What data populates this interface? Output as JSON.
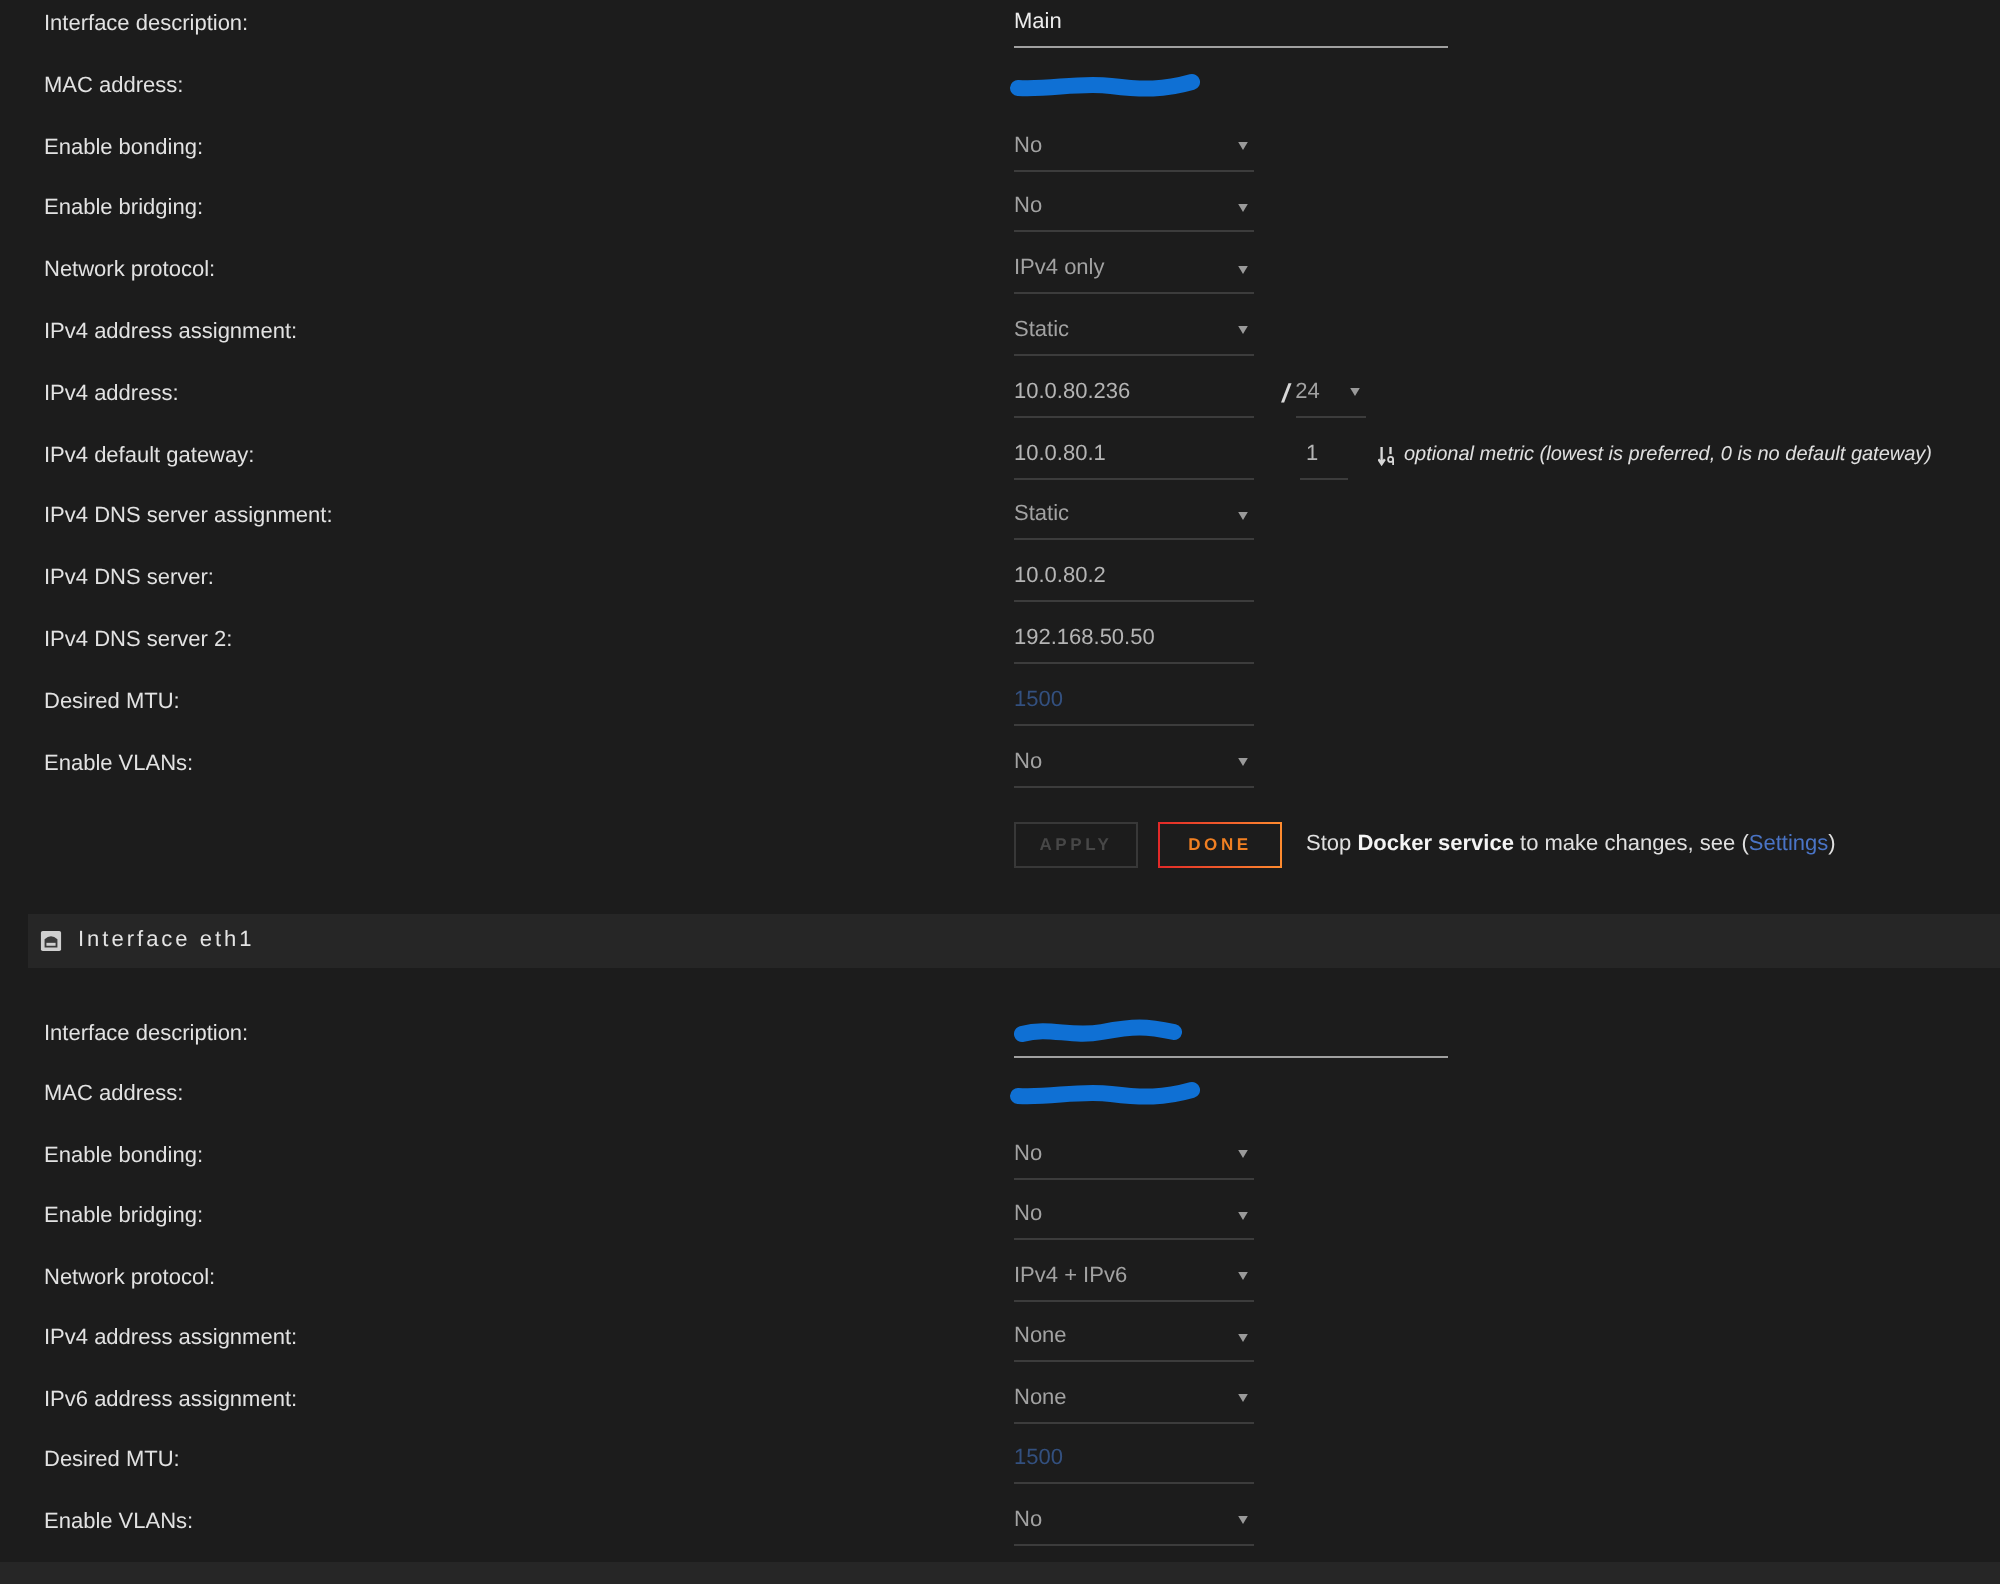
{
  "sections": [
    {
      "rows": [
        {
          "label": "Interface description:",
          "kind": "wide_input",
          "value": "Main",
          "redacted": false
        },
        {
          "label": "MAC address:",
          "kind": "text",
          "redacted": true
        },
        {
          "label": "Enable bonding:",
          "kind": "select",
          "value": "No"
        },
        {
          "label": "Enable bridging:",
          "kind": "select",
          "value": "No"
        },
        {
          "label": "Network protocol:",
          "kind": "select",
          "value": "IPv4 only"
        },
        {
          "label": "IPv4 address assignment:",
          "kind": "select",
          "value": "Static"
        },
        {
          "label": "IPv4 address:",
          "kind": "address",
          "value": "10.0.80.236",
          "separator": "/",
          "prefix": "24"
        },
        {
          "label": "IPv4 default gateway:",
          "kind": "gateway",
          "value": "10.0.80.1",
          "metric": "1",
          "hint": "optional metric (lowest is preferred, 0 is no default gateway)"
        },
        {
          "label": "IPv4 DNS server assignment:",
          "kind": "select",
          "value": "Static"
        },
        {
          "label": "IPv4 DNS server:",
          "kind": "input",
          "value": "10.0.80.2"
        },
        {
          "label": "IPv4 DNS server 2:",
          "kind": "input",
          "value": "192.168.50.50"
        },
        {
          "label": "Desired MTU:",
          "kind": "input",
          "placeholder": "1500"
        },
        {
          "label": "Enable VLANs:",
          "kind": "select",
          "value": "No"
        }
      ],
      "actions": {
        "buttons": [
          {
            "label": "APPLY",
            "disabled": true
          },
          {
            "label": "DONE",
            "disabled": false
          }
        ],
        "notice": {
          "text": "Stop **Docker service** to make changes, see (",
          "link": "Settings",
          "text_after": ")"
        }
      }
    },
    {
      "title": "Interface eth1",
      "rows": [
        {
          "label": "Interface description:",
          "kind": "wide_input",
          "redacted": true
        },
        {
          "label": "MAC address:",
          "kind": "text",
          "redacted": true
        },
        {
          "label": "Enable bonding:",
          "kind": "select",
          "value": "No"
        },
        {
          "label": "Enable bridging:",
          "kind": "select",
          "value": "No"
        },
        {
          "label": "Network protocol:",
          "kind": "select",
          "value": "IPv4 + IPv6"
        },
        {
          "label": "IPv4 address assignment:",
          "kind": "select",
          "value": "None"
        },
        {
          "label": "IPv6 address assignment:",
          "kind": "select",
          "value": "None"
        },
        {
          "label": "Desired MTU:",
          "kind": "input",
          "placeholder": "1500"
        },
        {
          "label": "Enable VLANs:",
          "kind": "select",
          "value": "No"
        }
      ]
    }
  ]
}
